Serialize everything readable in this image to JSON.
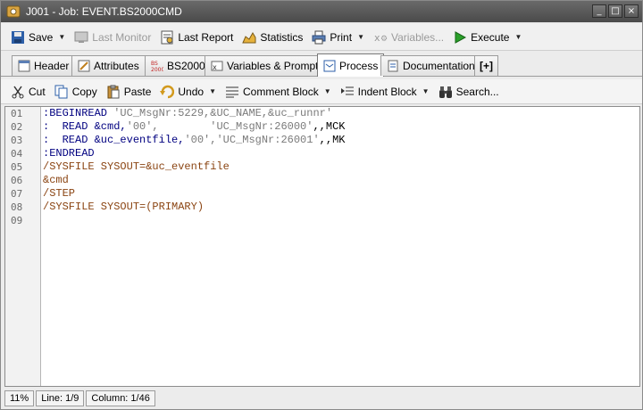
{
  "window": {
    "title": "J001 - Job: EVENT.BS2000CMD"
  },
  "toolbar": {
    "save": "Save",
    "last_monitor": "Last Monitor",
    "last_report": "Last Report",
    "statistics": "Statistics",
    "print": "Print",
    "variables": "Variables...",
    "execute": "Execute"
  },
  "tabs": [
    {
      "label": "Header"
    },
    {
      "label": "Attributes"
    },
    {
      "label": "BS2000"
    },
    {
      "label": "Variables & Prompts"
    },
    {
      "label": "Process"
    },
    {
      "label": "Documentation"
    },
    {
      "label": "[+]"
    }
  ],
  "active_tab": "Process",
  "edit_toolbar": {
    "cut": "Cut",
    "copy": "Copy",
    "paste": "Paste",
    "undo": "Undo",
    "comment_block": "Comment Block",
    "indent_block": "Indent Block",
    "search": "Search..."
  },
  "editor": {
    "line_numbers": [
      "01",
      "02",
      "03",
      "04",
      "05",
      "06",
      "07",
      "08",
      "09"
    ],
    "lines": [
      {
        "a": ":BEGINREAD ",
        "b": "'UC_MsgNr:5229,&UC_NAME,&uc_runnr'",
        "c": ""
      },
      {
        "a": ":  READ &cmd,",
        "b": "'00',        'UC_MsgNr:26000'",
        "c": ",,MCK"
      },
      {
        "a": ":  READ &uc_eventfile,",
        "b": "'00','UC_MsgNr:26001'",
        "c": ",,MK"
      },
      {
        "a": ":ENDREAD",
        "b": "",
        "c": ""
      },
      {
        "a": "/SYSFILE SYSOUT=&uc_eventfile",
        "b": "",
        "c": ""
      },
      {
        "a": "&cmd",
        "b": "",
        "c": ""
      },
      {
        "a": "/STEP",
        "b": "",
        "c": ""
      },
      {
        "a": "/SYSFILE SYSOUT=(PRIMARY)",
        "b": "",
        "c": ""
      },
      {
        "a": "",
        "b": "",
        "c": ""
      }
    ]
  },
  "status": {
    "zoom": "11%",
    "line": "Line: 1/9",
    "column": "Column: 1/46"
  },
  "colors": {
    "keyword": "#000080",
    "string": "#7a7a7a",
    "jcl": "#8b4513"
  }
}
